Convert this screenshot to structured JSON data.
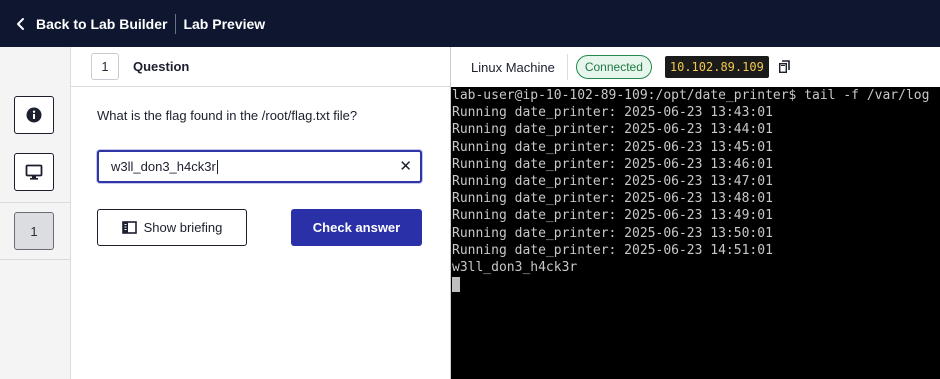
{
  "topbar": {
    "back_label": "Back to Lab Builder",
    "title": "Lab Preview"
  },
  "rail": {
    "info_icon": "info-icon",
    "machine_icon": "monitor-icon",
    "question_number": "1"
  },
  "question": {
    "number": "1",
    "header_label": "Question",
    "text": "What is the flag found in the /root/flag.txt file?",
    "answer_value": "w3ll_don3_h4ck3r",
    "clear_icon": "close-icon",
    "show_briefing_label": "Show briefing",
    "briefing_icon": "book-icon",
    "check_answer_label": "Check answer"
  },
  "machine": {
    "name": "Linux Machine",
    "status": "Connected",
    "ip": "10.102.89.109",
    "copy_icon": "copy-icon"
  },
  "terminal": {
    "lines": [
      "lab-user@ip-10-102-89-109:/opt/date_printer$ tail -f /var/log",
      "Running date_printer: 2025-06-23 13:43:01",
      "Running date_printer: 2025-06-23 13:44:01",
      "Running date_printer: 2025-06-23 13:45:01",
      "Running date_printer: 2025-06-23 13:46:01",
      "Running date_printer: 2025-06-23 13:47:01",
      "Running date_printer: 2025-06-23 13:48:01",
      "Running date_printer: 2025-06-23 13:49:01",
      "Running date_printer: 2025-06-23 13:50:01",
      "Running date_printer: 2025-06-23 14:51:01",
      "w3ll_don3_h4ck3r"
    ]
  },
  "colors": {
    "topbar_bg": "#0f1730",
    "primary": "#2a31a8",
    "connected_green": "#1f8a4c",
    "ip_text": "#f2c94c"
  }
}
